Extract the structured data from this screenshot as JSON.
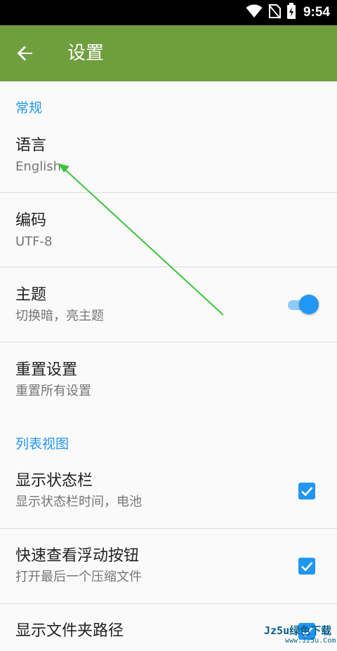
{
  "status_bar": {
    "time": "9:54",
    "icons": [
      "wifi-icon",
      "no-sim-icon",
      "battery-charging-icon"
    ]
  },
  "app_bar": {
    "back_icon": "arrow-back-icon",
    "title": "设置",
    "color": "#6f9e3f"
  },
  "sections": {
    "general": {
      "header": "常规",
      "language": {
        "title": "语言",
        "summary": "English"
      },
      "encoding": {
        "title": "编码",
        "summary": "UTF-8"
      },
      "theme": {
        "title": "主题",
        "summary": "切换暗，亮主题",
        "enabled": true
      },
      "reset": {
        "title": "重置设置",
        "summary": "重置所有设置"
      }
    },
    "list_view": {
      "header": "列表视图",
      "show_status_bar": {
        "title": "显示状态栏",
        "summary": "显示状态栏时间，电池",
        "checked": true
      },
      "quick_view_fab": {
        "title": "快速查看浮动按钮",
        "summary": "打开最后一个压缩文件",
        "checked": true
      },
      "show_folder_path": {
        "title": "显示文件夹路径",
        "checked": true
      }
    }
  },
  "colors": {
    "accent": "#2196f3",
    "annotation_arrow": "#3bc43b"
  },
  "watermark": {
    "main": "Jz5u绿色下载",
    "sub": "www.Jz5u.Com"
  }
}
